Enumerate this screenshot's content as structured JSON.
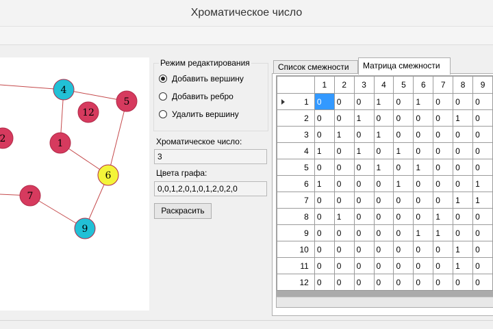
{
  "window": {
    "title": "Хроматическое число"
  },
  "colors": {
    "red": "#d63a5e",
    "blue": "#22c0d6",
    "yellow": "#f4f43a",
    "edge": "#c4484a",
    "selection": "#3399ff"
  },
  "graph": {
    "vertices": [
      {
        "id": "1",
        "color": "red"
      },
      {
        "id": "2",
        "color": "red"
      },
      {
        "id": "4",
        "color": "blue"
      },
      {
        "id": "5",
        "color": "red"
      },
      {
        "id": "6",
        "color": "yellow"
      },
      {
        "id": "7",
        "color": "red"
      },
      {
        "id": "9",
        "color": "blue"
      },
      {
        "id": "12",
        "color": "red"
      }
    ]
  },
  "edit_mode": {
    "title": "Режим редактирования",
    "options": [
      {
        "label": "Добавить вершину",
        "selected": true
      },
      {
        "label": "Добавить ребро",
        "selected": false
      },
      {
        "label": "Удалить вершину",
        "selected": false
      }
    ]
  },
  "chromatic": {
    "label": "Хроматическое число:",
    "value": "3"
  },
  "graph_colors": {
    "label": "Цвета графа:",
    "value": "0,0,1,2,0,1,0,1,2,0,2,0"
  },
  "colorize_button": "Раскрасить",
  "tabs": [
    {
      "label": "Список смежности",
      "active": false
    },
    {
      "label": "Матрица смежности",
      "active": true
    }
  ],
  "matrix": {
    "columns": [
      "1",
      "2",
      "3",
      "4",
      "5",
      "6",
      "7",
      "8",
      "9"
    ],
    "rows": [
      {
        "label": "1",
        "cells": [
          "0",
          "0",
          "0",
          "1",
          "0",
          "1",
          "0",
          "0",
          "0"
        ]
      },
      {
        "label": "2",
        "cells": [
          "0",
          "0",
          "1",
          "0",
          "0",
          "0",
          "0",
          "1",
          "0"
        ]
      },
      {
        "label": "3",
        "cells": [
          "0",
          "1",
          "0",
          "1",
          "0",
          "0",
          "0",
          "0",
          "0"
        ]
      },
      {
        "label": "4",
        "cells": [
          "1",
          "0",
          "1",
          "0",
          "1",
          "0",
          "0",
          "0",
          "0"
        ]
      },
      {
        "label": "5",
        "cells": [
          "0",
          "0",
          "0",
          "1",
          "0",
          "1",
          "0",
          "0",
          "0"
        ]
      },
      {
        "label": "6",
        "cells": [
          "1",
          "0",
          "0",
          "0",
          "1",
          "0",
          "0",
          "0",
          "1"
        ]
      },
      {
        "label": "7",
        "cells": [
          "0",
          "0",
          "0",
          "0",
          "0",
          "0",
          "0",
          "1",
          "1"
        ]
      },
      {
        "label": "8",
        "cells": [
          "0",
          "1",
          "0",
          "0",
          "0",
          "0",
          "1",
          "0",
          "0"
        ]
      },
      {
        "label": "9",
        "cells": [
          "0",
          "0",
          "0",
          "0",
          "0",
          "1",
          "1",
          "0",
          "0"
        ]
      },
      {
        "label": "10",
        "cells": [
          "0",
          "0",
          "0",
          "0",
          "0",
          "0",
          "0",
          "1",
          "0"
        ]
      },
      {
        "label": "11",
        "cells": [
          "0",
          "0",
          "0",
          "0",
          "0",
          "0",
          "0",
          "1",
          "0"
        ]
      },
      {
        "label": "12",
        "cells": [
          "0",
          "0",
          "0",
          "0",
          "0",
          "0",
          "0",
          "0",
          "0"
        ]
      }
    ]
  }
}
